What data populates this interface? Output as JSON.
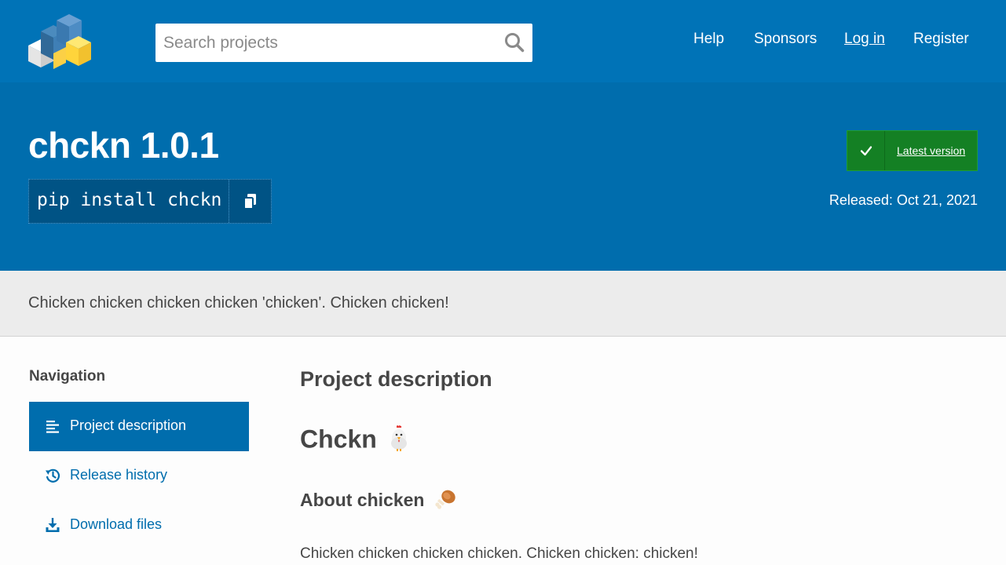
{
  "header": {
    "search_placeholder": "Search projects",
    "nav": {
      "help": "Help",
      "sponsors": "Sponsors",
      "login": "Log in",
      "register": "Register"
    }
  },
  "banner": {
    "title": "chckn 1.0.1",
    "pip_command": "pip install chckn",
    "latest_version_label": "Latest version",
    "released": "Released: Oct 21, 2021"
  },
  "summary": "Chicken chicken chicken chicken 'chicken'. Chicken chicken!",
  "sidebar": {
    "heading": "Navigation",
    "items": [
      {
        "label": "Project description",
        "icon": "align-left-icon",
        "active": true
      },
      {
        "label": "Release history",
        "icon": "history-icon",
        "active": false
      },
      {
        "label": "Download files",
        "icon": "download-icon",
        "active": false
      }
    ]
  },
  "main": {
    "section_title": "Project description",
    "h1": "Chckn",
    "h1_icon": "chicken-emoji-icon",
    "h2": "About chicken",
    "h2_icon": "poultry-leg-emoji-icon",
    "paragraph": "Chicken chicken chicken chicken. Chicken chicken: chicken!"
  },
  "colors": {
    "header_bg": "#0073b7",
    "banner_bg": "#006dad",
    "pip_bg": "#005385",
    "latest_green": "#148024",
    "summary_bg": "#ececec",
    "link_blue": "#006dad"
  }
}
